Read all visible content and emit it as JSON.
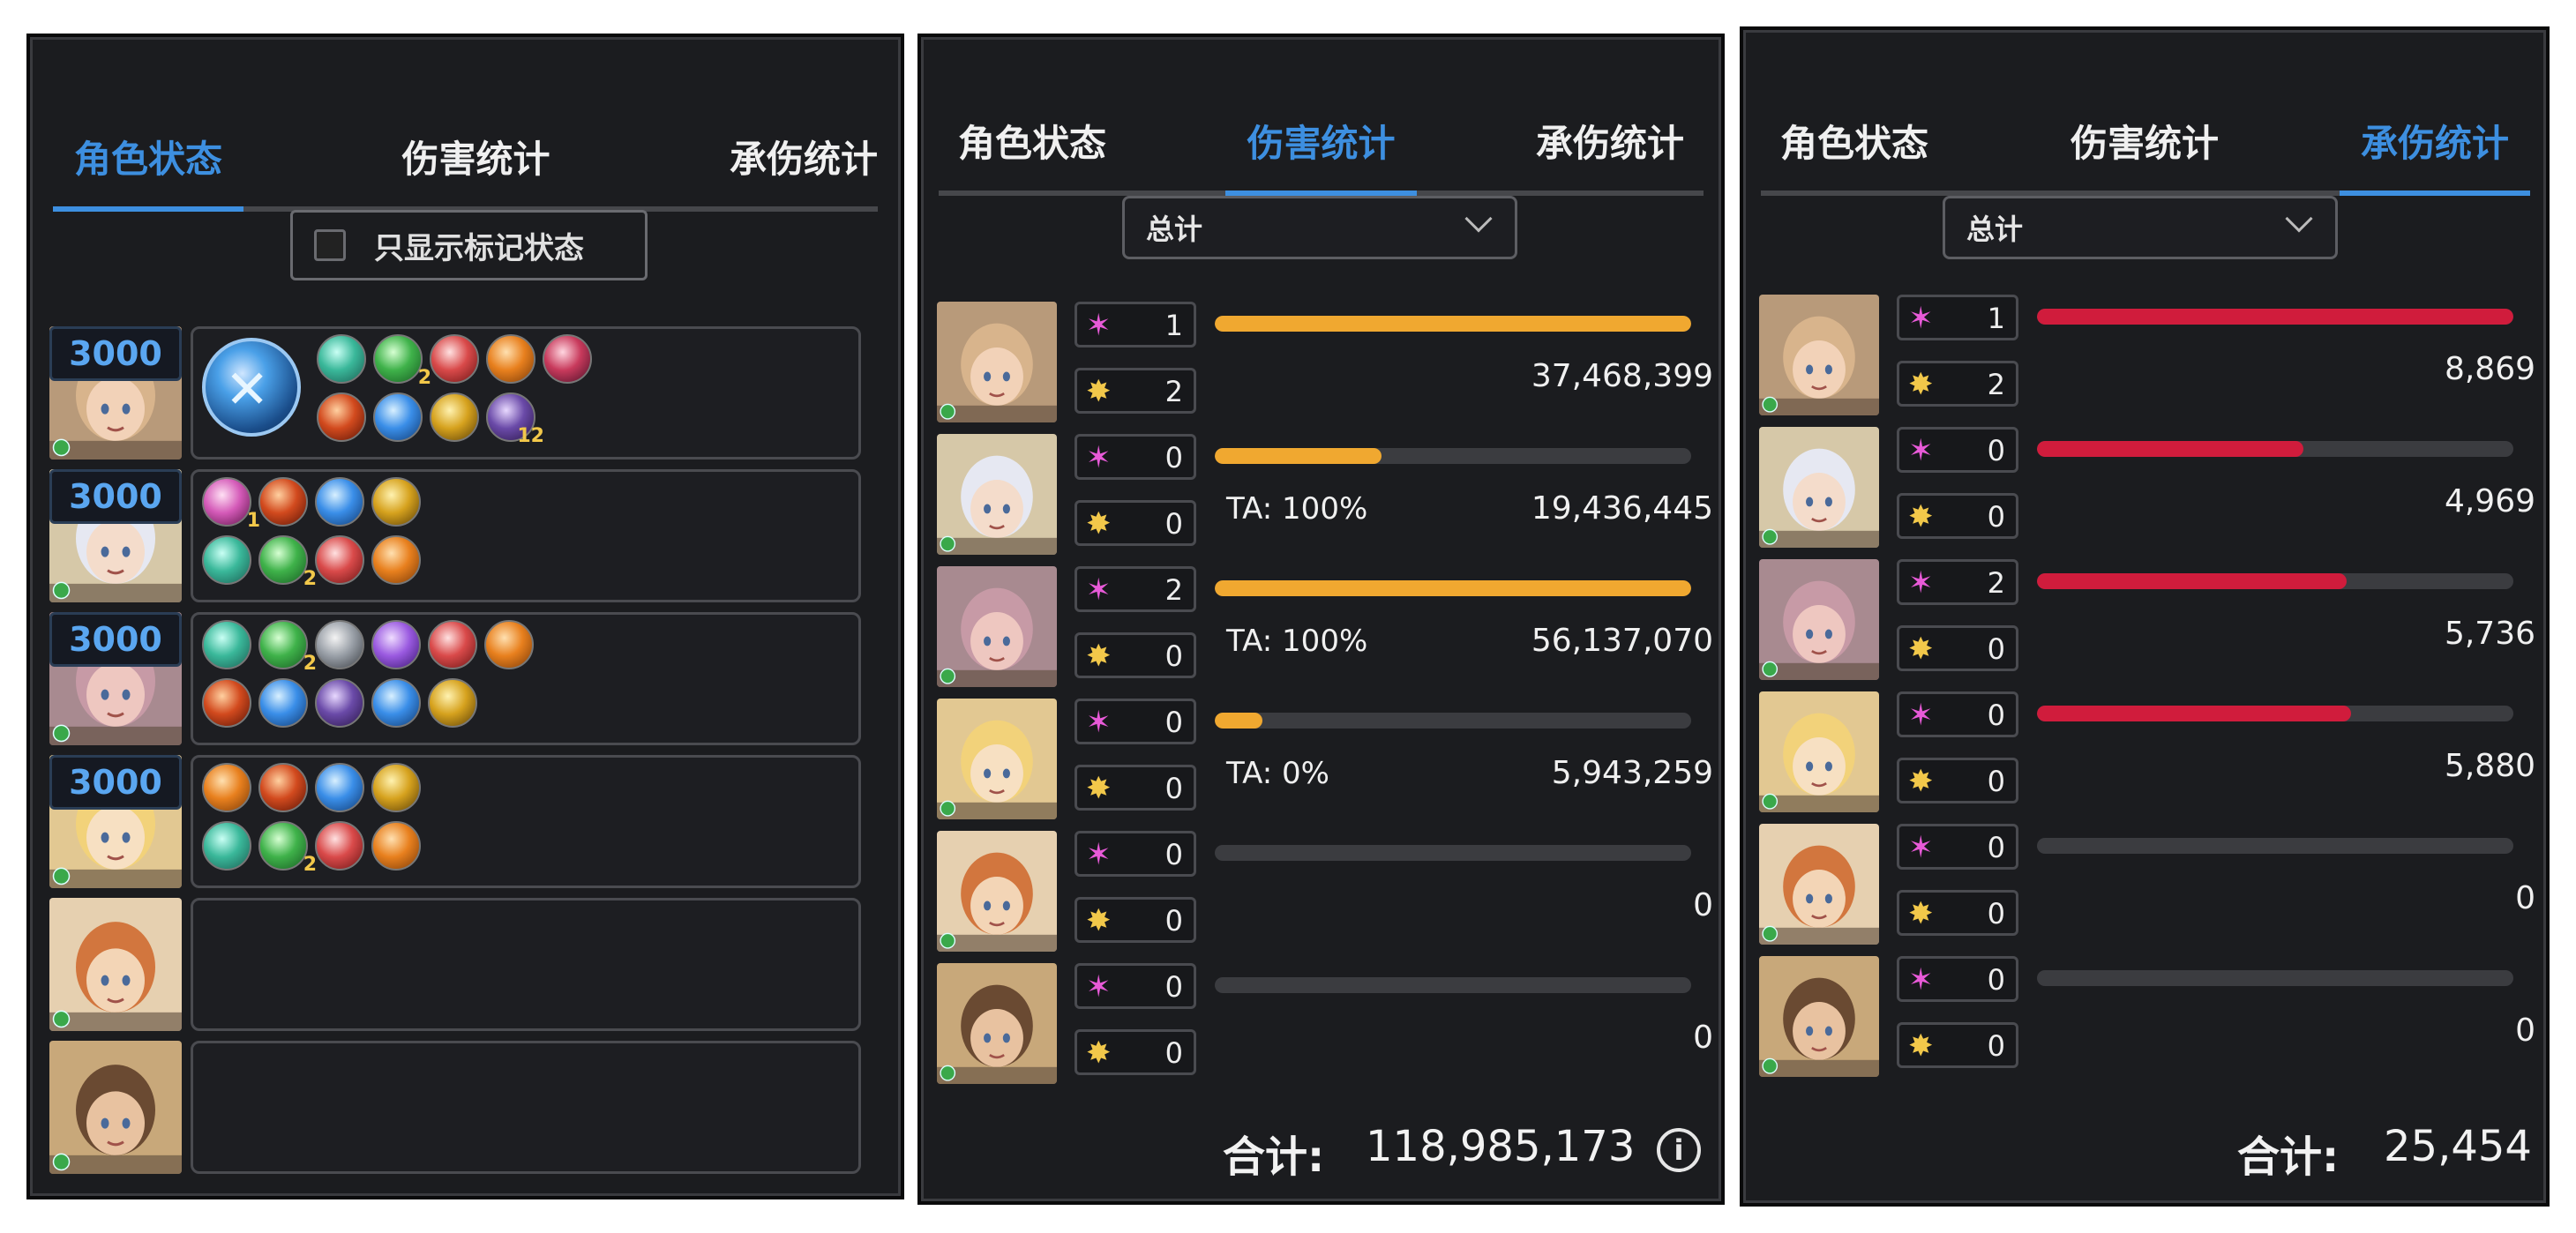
{
  "colors": {
    "accent": "#3d8fe0",
    "damage_bar": "#f0a830",
    "taken_bar": "#d01c3c",
    "hp_text": "#5aa6f0"
  },
  "tabs": [
    "角色状态",
    "伤害统计",
    "承伤统计"
  ],
  "panel1": {
    "active_tab": 0,
    "checkbox_label": "只显示标记状态",
    "checkbox_checked": false,
    "rows": [
      {
        "hp": "3000",
        "main_icon": "sword-skill-icon",
        "icons_row1": [
          {
            "c": "teal"
          },
          {
            "c": "green",
            "n": "2"
          },
          {
            "c": "red"
          },
          {
            "c": "orange"
          },
          {
            "c": "gem"
          }
        ],
        "icons_row2": [
          {
            "c": "flame"
          },
          {
            "c": "blue"
          },
          {
            "c": "gold"
          },
          {
            "c": "darkpurple",
            "n": "12"
          }
        ]
      },
      {
        "hp": "3000",
        "icons_row1": [
          {
            "c": "pink",
            "n": "1"
          },
          {
            "c": "flame"
          },
          {
            "c": "blue"
          },
          {
            "c": "gold"
          }
        ],
        "icons_row2": [
          {
            "c": "teal"
          },
          {
            "c": "green",
            "n": "2"
          },
          {
            "c": "red"
          },
          {
            "c": "orange"
          }
        ]
      },
      {
        "hp": "3000",
        "icons_row1": [
          {
            "c": "teal"
          },
          {
            "c": "green",
            "n": "2"
          },
          {
            "c": "grey"
          },
          {
            "c": "purple"
          },
          {
            "c": "red"
          },
          {
            "c": "orange"
          }
        ],
        "icons_row2": [
          {
            "c": "flame"
          },
          {
            "c": "blue"
          },
          {
            "c": "darkpurple"
          },
          {
            "c": "blue"
          },
          {
            "c": "gold"
          }
        ]
      },
      {
        "hp": "3000",
        "icons_row1": [
          {
            "c": "orange"
          },
          {
            "c": "flame"
          },
          {
            "c": "blue"
          },
          {
            "c": "gold"
          }
        ],
        "icons_row2": [
          {
            "c": "teal"
          },
          {
            "c": "green",
            "n": "2"
          },
          {
            "c": "red"
          },
          {
            "c": "orange"
          }
        ]
      },
      {
        "hp": "",
        "icons_row1": [],
        "icons_row2": []
      },
      {
        "hp": "",
        "icons_row1": [],
        "icons_row2": []
      }
    ]
  },
  "panel2": {
    "active_tab": 1,
    "dropdown": "总计",
    "rows": [
      {
        "ougi": "1",
        "ca": "2",
        "bar_frac": 1.0,
        "ta": "",
        "value": "37,468,399"
      },
      {
        "ougi": "0",
        "ca": "0",
        "bar_frac": 0.35,
        "ta": "TA: 100%",
        "value": "19,436,445"
      },
      {
        "ougi": "2",
        "ca": "0",
        "bar_frac": 1.0,
        "ta": "TA: 100%",
        "value": "56,137,070"
      },
      {
        "ougi": "0",
        "ca": "0",
        "bar_frac": 0.1,
        "ta": "TA: 0%",
        "value": "5,943,259"
      },
      {
        "ougi": "0",
        "ca": "0",
        "bar_frac": 0,
        "ta": "",
        "value": "0"
      },
      {
        "ougi": "0",
        "ca": "0",
        "bar_frac": 0,
        "ta": "",
        "value": "0"
      }
    ],
    "total_label": "合计:",
    "total_value": "118,985,173",
    "info": "i"
  },
  "panel3": {
    "active_tab": 2,
    "dropdown": "总计",
    "rows": [
      {
        "ougi": "1",
        "ca": "2",
        "bar_frac": 1.0,
        "value": "8,869"
      },
      {
        "ougi": "0",
        "ca": "0",
        "bar_frac": 0.56,
        "value": "4,969"
      },
      {
        "ougi": "2",
        "ca": "0",
        "bar_frac": 0.65,
        "value": "5,736"
      },
      {
        "ougi": "0",
        "ca": "0",
        "bar_frac": 0.66,
        "value": "5,880"
      },
      {
        "ougi": "0",
        "ca": "0",
        "bar_frac": 0,
        "value": "0"
      },
      {
        "ougi": "0",
        "ca": "0",
        "bar_frac": 0,
        "value": "0"
      }
    ],
    "total_label": "合计:",
    "total_value": "25,454"
  }
}
